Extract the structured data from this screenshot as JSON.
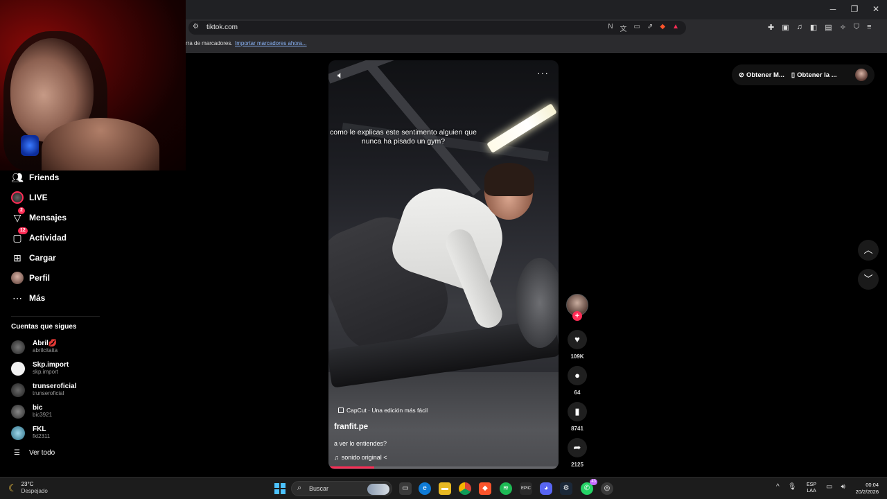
{
  "browser": {
    "url": "tiktok.com",
    "window_controls": [
      "─",
      "❐",
      "✕"
    ],
    "bookmarks_partial": "rra de marcadores.",
    "bookmarks_import_link": "Importar marcadores ahora..."
  },
  "sidebar": {
    "items": [
      {
        "label": "Friends",
        "icon": "friends-icon"
      },
      {
        "label": "LIVE",
        "icon": "live-icon"
      },
      {
        "label": "Mensajes",
        "icon": "messages-icon",
        "badge": "2"
      },
      {
        "label": "Actividad",
        "icon": "activity-icon",
        "badge": "12"
      },
      {
        "label": "Cargar",
        "icon": "upload-icon"
      },
      {
        "label": "Perfil",
        "icon": "profile-icon"
      },
      {
        "label": "Más",
        "icon": "more-icon"
      }
    ],
    "following_title": "Cuentas que sigues",
    "following": [
      {
        "name": "Abril💋",
        "handle": "abrilcitaita"
      },
      {
        "name": "Skp.import",
        "handle": "skp.import"
      },
      {
        "name": "trunseroficial",
        "handle": "trunseroficial"
      },
      {
        "name": "bic",
        "handle": "bic3921"
      },
      {
        "name": "FKL",
        "handle": "fkl2311"
      }
    ],
    "see_all": "Ver todo"
  },
  "video": {
    "caption": "como le explicas este sentimento alguien que nunca ha pisado un gym?",
    "capcut": "CapCut · Una edición más fácil",
    "author": "franfit.pe",
    "description": "a ver lo entiendes?",
    "sound": "sonido original <",
    "progress": 0.2
  },
  "actions": {
    "likes": "109K",
    "comments": "64",
    "saves": "8741",
    "shares": "2125"
  },
  "top_right": {
    "get_app_1": "Obtener M...",
    "get_app_2": "Obtener la ..."
  },
  "taskbar": {
    "temperature": "23°C",
    "weather": "Despejado",
    "search_placeholder": "Buscar",
    "whatsapp_badge": "43",
    "lang_1": "ESP",
    "lang_2": "LAA",
    "time": "00:04",
    "date": "20/2/2026"
  },
  "colors": {
    "accent": "#fe2c55",
    "background": "#000000"
  }
}
